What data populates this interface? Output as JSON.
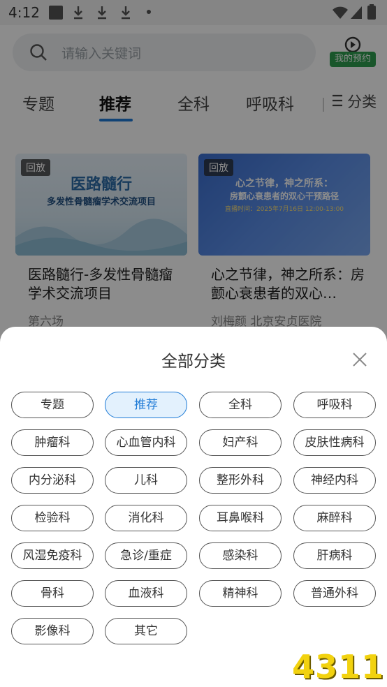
{
  "status": {
    "time": "4:12"
  },
  "search": {
    "placeholder": "请输入关键词"
  },
  "booking": {
    "label": "我的预约"
  },
  "tabs": [
    {
      "label": "专题"
    },
    {
      "label": "推荐"
    },
    {
      "label": "全科"
    },
    {
      "label": "呼吸科"
    },
    {
      "label": "分类"
    }
  ],
  "cards": [
    {
      "tag": "回放",
      "image_title": "医路髓行",
      "image_subtitle": "多发性骨髓瘤学术交流项目",
      "title": "医路髓行-多发性骨髓瘤学术交流项目",
      "meta": "第六场"
    },
    {
      "tag": "回放",
      "image_title": "心之节律，神之所系：",
      "image_subtitle": "房颤心衰患者的双心干预路径",
      "image_time": "直播时间：2025年7月16日 12:00-13:00",
      "title": "心之节律，神之所系：房颤心衰患者的双心…",
      "meta": "刘梅颜  北京安贞医院"
    }
  ],
  "sheet": {
    "title": "全部分类",
    "categories": [
      "专题",
      "推荐",
      "全科",
      "呼吸科",
      "肿瘤科",
      "心血管内科",
      "妇产科",
      "皮肤性病科",
      "内分泌科",
      "儿科",
      "整形外科",
      "神经内科",
      "检验科",
      "消化科",
      "耳鼻喉科",
      "麻醉科",
      "风湿免疫科",
      "急诊/重症",
      "感染科",
      "肝病科",
      "骨科",
      "血液科",
      "精神科",
      "普通外科",
      "影像科",
      "其它"
    ],
    "selected": "推荐"
  },
  "watermark": "4311",
  "colors": {
    "accent": "#1f7bd6",
    "booking_green": "#2e9d4f"
  }
}
